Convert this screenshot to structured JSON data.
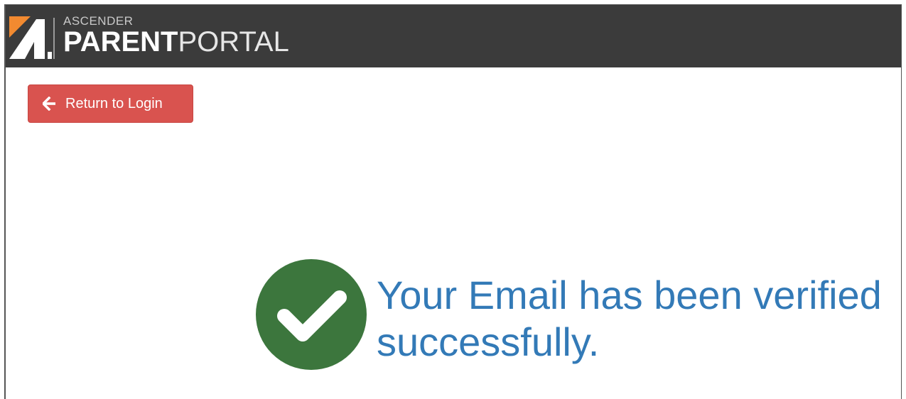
{
  "header": {
    "brand_small": "ASCENDER",
    "brand_bold": "PARENT",
    "brand_thin": "PORTAL",
    "background_color": "#3b3b3b",
    "logo_accent_color": "#f28a30"
  },
  "actions": {
    "return_label": "Return to Login",
    "return_icon": "arrow-left-icon",
    "button_color": "#d9534f"
  },
  "message": {
    "line1": "Your Email has been verified",
    "line2": "successfully.",
    "icon": "check-circle-icon",
    "icon_color": "#3c763d",
    "text_color": "#337ab7"
  }
}
